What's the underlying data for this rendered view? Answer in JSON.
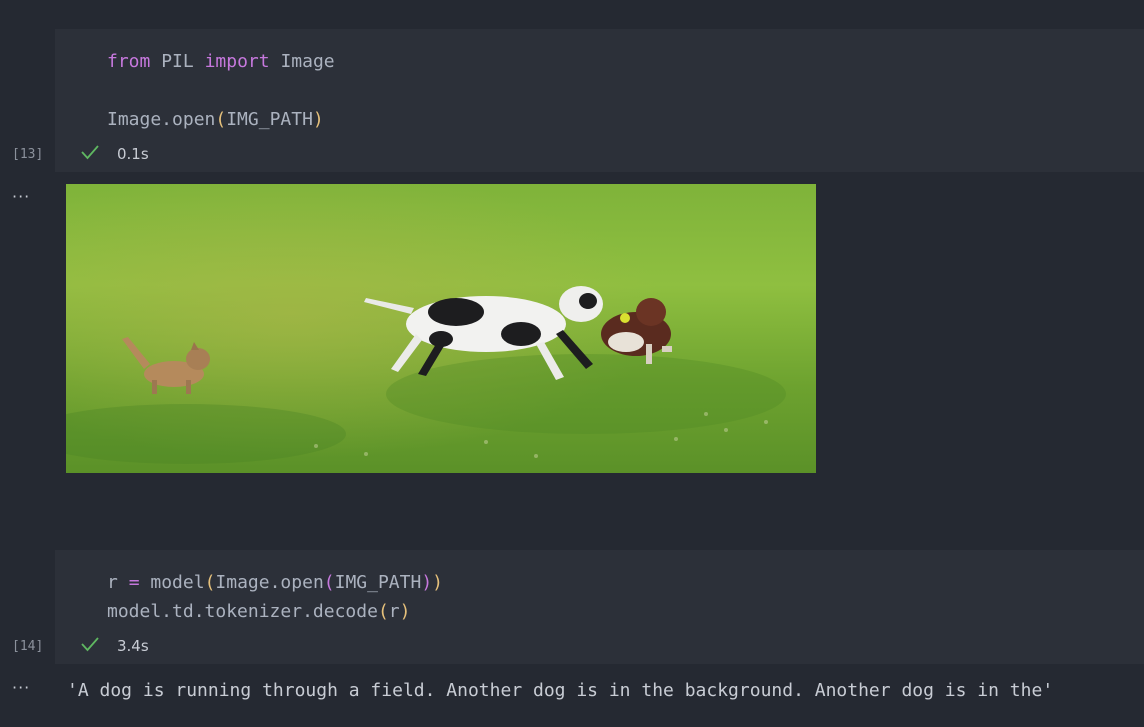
{
  "cell1": {
    "execution_count": "[13]",
    "code_line1": {
      "kw1": "from",
      "mod": "PIL",
      "kw2": "import",
      "name": "Image"
    },
    "code_line3": {
      "func": "Image.open",
      "open_paren": "(",
      "arg": "IMG_PATH",
      "close_paren": ")"
    },
    "status_icon": "checkmark-icon",
    "duration": "0.1s",
    "output_menu": "···"
  },
  "cell2": {
    "execution_count": "[14]",
    "code_line1": {
      "var": "r",
      "op": "=",
      "func": "model",
      "p1": "(",
      "inner_func": "Image.open",
      "p2": "(",
      "arg": "IMG_PATH",
      "p3": ")",
      "p4": ")"
    },
    "code_line2": {
      "func": "model.td.tokenizer.decode",
      "p1": "(",
      "arg": "r",
      "p2": ")"
    },
    "status_icon": "checkmark-icon",
    "duration": "3.4s",
    "output_menu": "···",
    "output_text": "'A dog is running through a field. Another dog is in the background. Another dog is in the'"
  },
  "colors": {
    "background": "#252932",
    "cell_background": "#2c3039",
    "keyword": "#c678dd",
    "paren_outer": "#e5c07b",
    "paren_inner": "#c678dd",
    "success": "#5fb761"
  }
}
